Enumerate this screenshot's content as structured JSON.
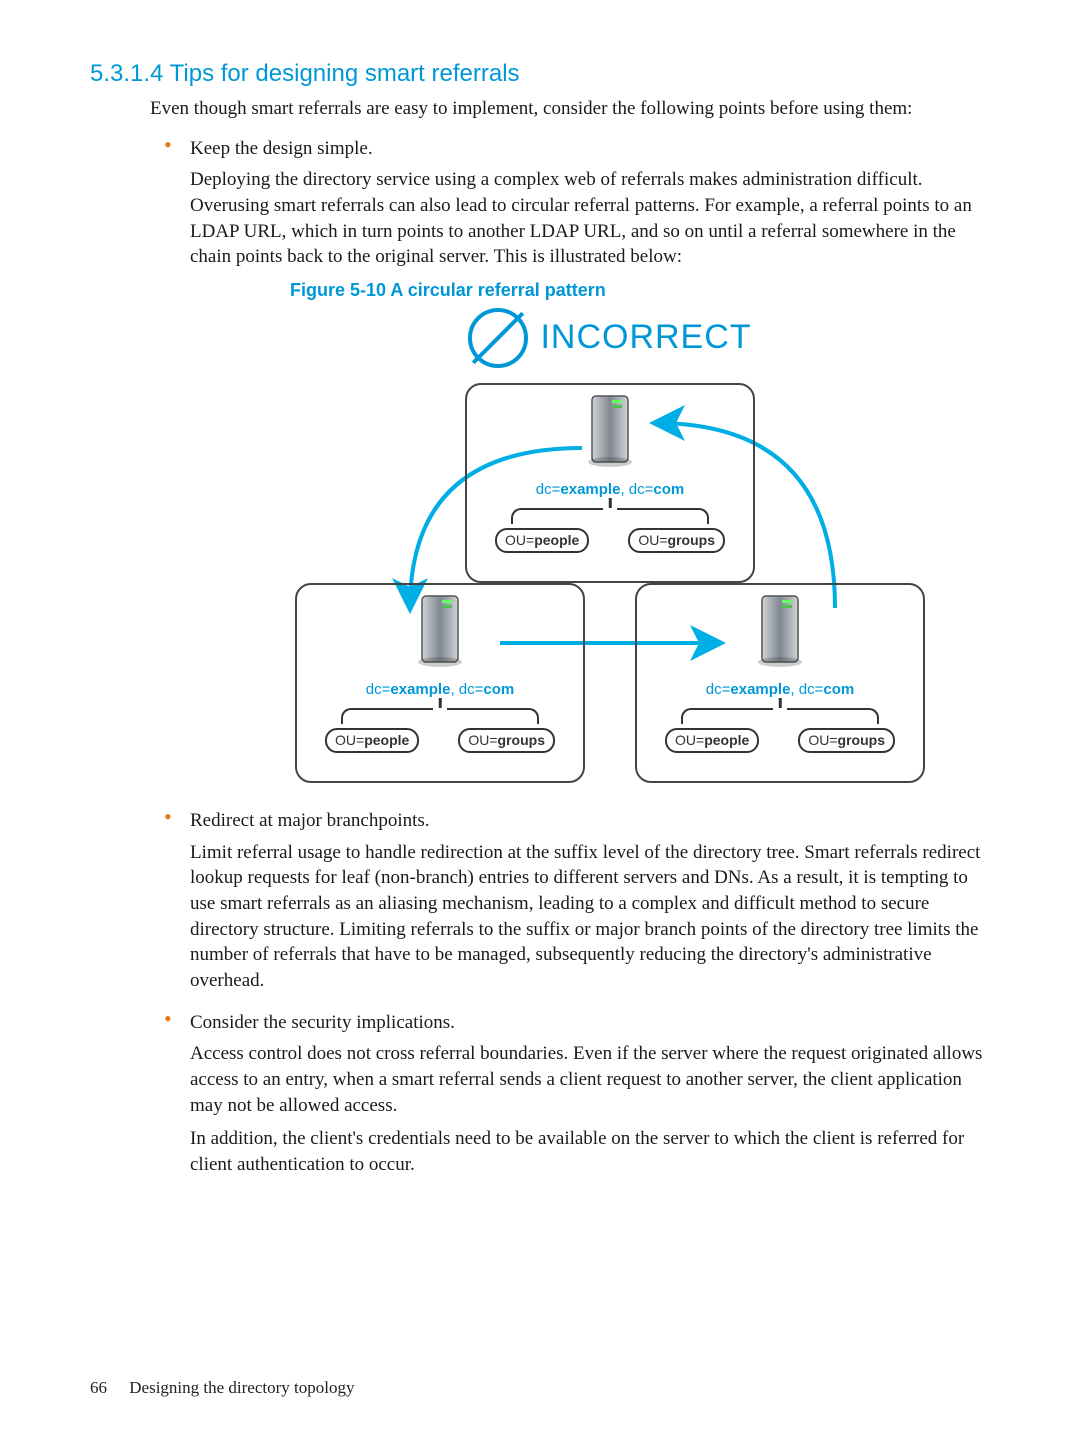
{
  "heading": "5.3.1.4 Tips for designing smart referrals",
  "intro": "Even though smart referrals are easy to implement, consider the following points before using them:",
  "bullets": [
    {
      "title": "Keep the design simple.",
      "body": "Deploying the directory service using a complex web of referrals makes administration difficult. Overusing smart referrals can also lead to circular referral patterns. For example, a referral points to an LDAP URL, which in turn points to another LDAP URL, and so on until a referral somewhere in the chain points back to the original server. This is illustrated below:"
    },
    {
      "title": "Redirect at major branchpoints.",
      "body": "Limit referral usage to handle redirection at the suffix level of the directory tree. Smart referrals redirect lookup requests for leaf (non-branch) entries to different servers and DNs. As a result, it is tempting to use smart referrals as an aliasing mechanism, leading to a complex and difficult method to secure directory structure. Limiting referrals to the suffix or major branch points of the directory tree limits the number of referrals that have to be managed, subsequently reducing the directory's administrative overhead."
    },
    {
      "title": "Consider the security implications.",
      "body": "Access control does not cross referral boundaries. Even if the server where the request originated allows access to an entry, when a smart referral sends a client request to another server, the client application may not be allowed access.",
      "body2": "In addition, the client's credentials need to be available on the server to which the client is referred for client authentication to occur."
    }
  ],
  "figure": {
    "caption": "Figure 5-10 A circular referral pattern",
    "banner": "INCORRECT",
    "dc_html": "dc=<b>example</b>, dc=<b>com</b>",
    "ou_people_k": "OU=",
    "ou_people_v": "people",
    "ou_groups_k": "OU=",
    "ou_groups_v": "groups"
  },
  "footer": {
    "page": "66",
    "chapter": "Designing the directory topology"
  }
}
